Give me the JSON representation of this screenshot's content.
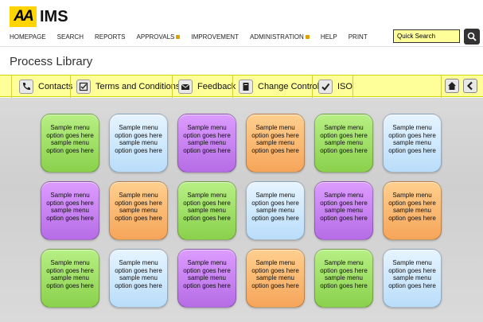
{
  "app": {
    "logo": "AA",
    "name": "IMS"
  },
  "nav": [
    "HOMEPAGE",
    "SEARCH",
    "REPORTS",
    "APPROVALS",
    "IMPROVEMENT",
    "ADMINISTRATION",
    "HELP",
    "PRINT"
  ],
  "search": {
    "placeholder": "Quick Search"
  },
  "page": {
    "title": "Process Library"
  },
  "toolbar": {
    "contacts": "Contacts",
    "terms": "Terms and Conditions",
    "feedback": "Feedback",
    "change_control": "Change Control",
    "iso": "ISO"
  },
  "tile_text": [
    "Sample menu",
    "option goes here",
    "sample menu",
    "option goes here"
  ],
  "tiles": [
    [
      "green",
      "blue",
      "purple",
      "orange",
      "green",
      "blue"
    ],
    [
      "purple",
      "orange",
      "green",
      "blue",
      "purple",
      "orange"
    ],
    [
      "green",
      "blue",
      "purple",
      "orange",
      "green",
      "blue"
    ]
  ],
  "colors": {
    "accent": "#ffff99",
    "logo": "#ffd400"
  }
}
